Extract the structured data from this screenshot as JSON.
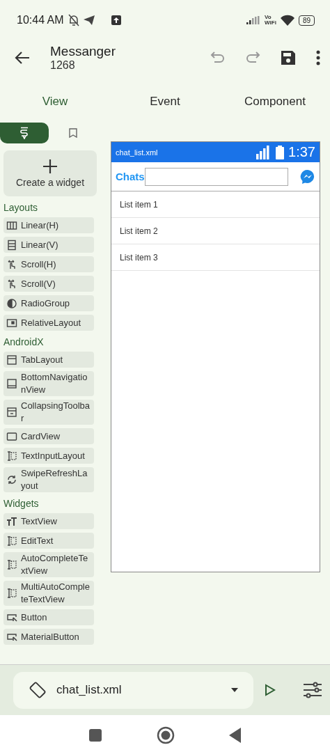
{
  "status_bar": {
    "time": "10:44 AM",
    "wifi_badge_top": "Vo",
    "wifi_badge_bottom": "WiFi",
    "battery": "89"
  },
  "app_bar": {
    "title": "Messanger",
    "subtitle": "1268",
    "undo_disabled": true,
    "redo_disabled": true
  },
  "tabs": [
    {
      "label": "View",
      "selected": true
    },
    {
      "label": "Event",
      "selected": false
    },
    {
      "label": "Component",
      "selected": false
    }
  ],
  "side_tabs": [
    {
      "kind": "palette",
      "selected": true
    },
    {
      "kind": "bookmark",
      "selected": false
    }
  ],
  "create_widget": "Create a widget",
  "sections": [
    {
      "title": "Layouts",
      "items": [
        {
          "label": "Linear(H)",
          "kind": "columns"
        },
        {
          "label": "Linear(V)",
          "kind": "rows"
        },
        {
          "label": "Scroll(H)",
          "kind": "hand"
        },
        {
          "label": "Scroll(V)",
          "kind": "hand"
        },
        {
          "label": "RadioGroup",
          "kind": "radio"
        },
        {
          "label": "RelativeLayout",
          "kind": "frame"
        }
      ]
    },
    {
      "title": "AndroidX",
      "items": [
        {
          "label": "TabLayout",
          "kind": "tab"
        },
        {
          "label": "BottomNavigationView",
          "kind": "bottomnav"
        },
        {
          "label": "CollapsingToolbar",
          "kind": "toolbar"
        },
        {
          "label": "CardView",
          "kind": "card"
        },
        {
          "label": "TextInputLayout",
          "kind": "input"
        },
        {
          "label": "SwipeRefreshLayout",
          "kind": "refresh"
        }
      ]
    },
    {
      "title": "Widgets",
      "items": [
        {
          "label": "TextView",
          "kind": "text"
        },
        {
          "label": "EditText",
          "kind": "input"
        },
        {
          "label": "AutoCompleteTextView",
          "kind": "input"
        },
        {
          "label": "MultiAutoCompleteTextView",
          "kind": "input"
        },
        {
          "label": "Button",
          "kind": "button"
        },
        {
          "label": "MaterialButton",
          "kind": "button"
        }
      ]
    }
  ],
  "preview": {
    "file_title": "chat_list.xml",
    "clock": "1:37",
    "toolbar_title": "Chats",
    "list_items": [
      "List item 1",
      "List item 2",
      "List item 3"
    ]
  },
  "bottom_bar": {
    "file": "chat_list.xml"
  },
  "nav_bar": {
    "buttons": [
      {
        "kind": "recents"
      },
      {
        "kind": "home"
      },
      {
        "kind": "back"
      }
    ]
  }
}
